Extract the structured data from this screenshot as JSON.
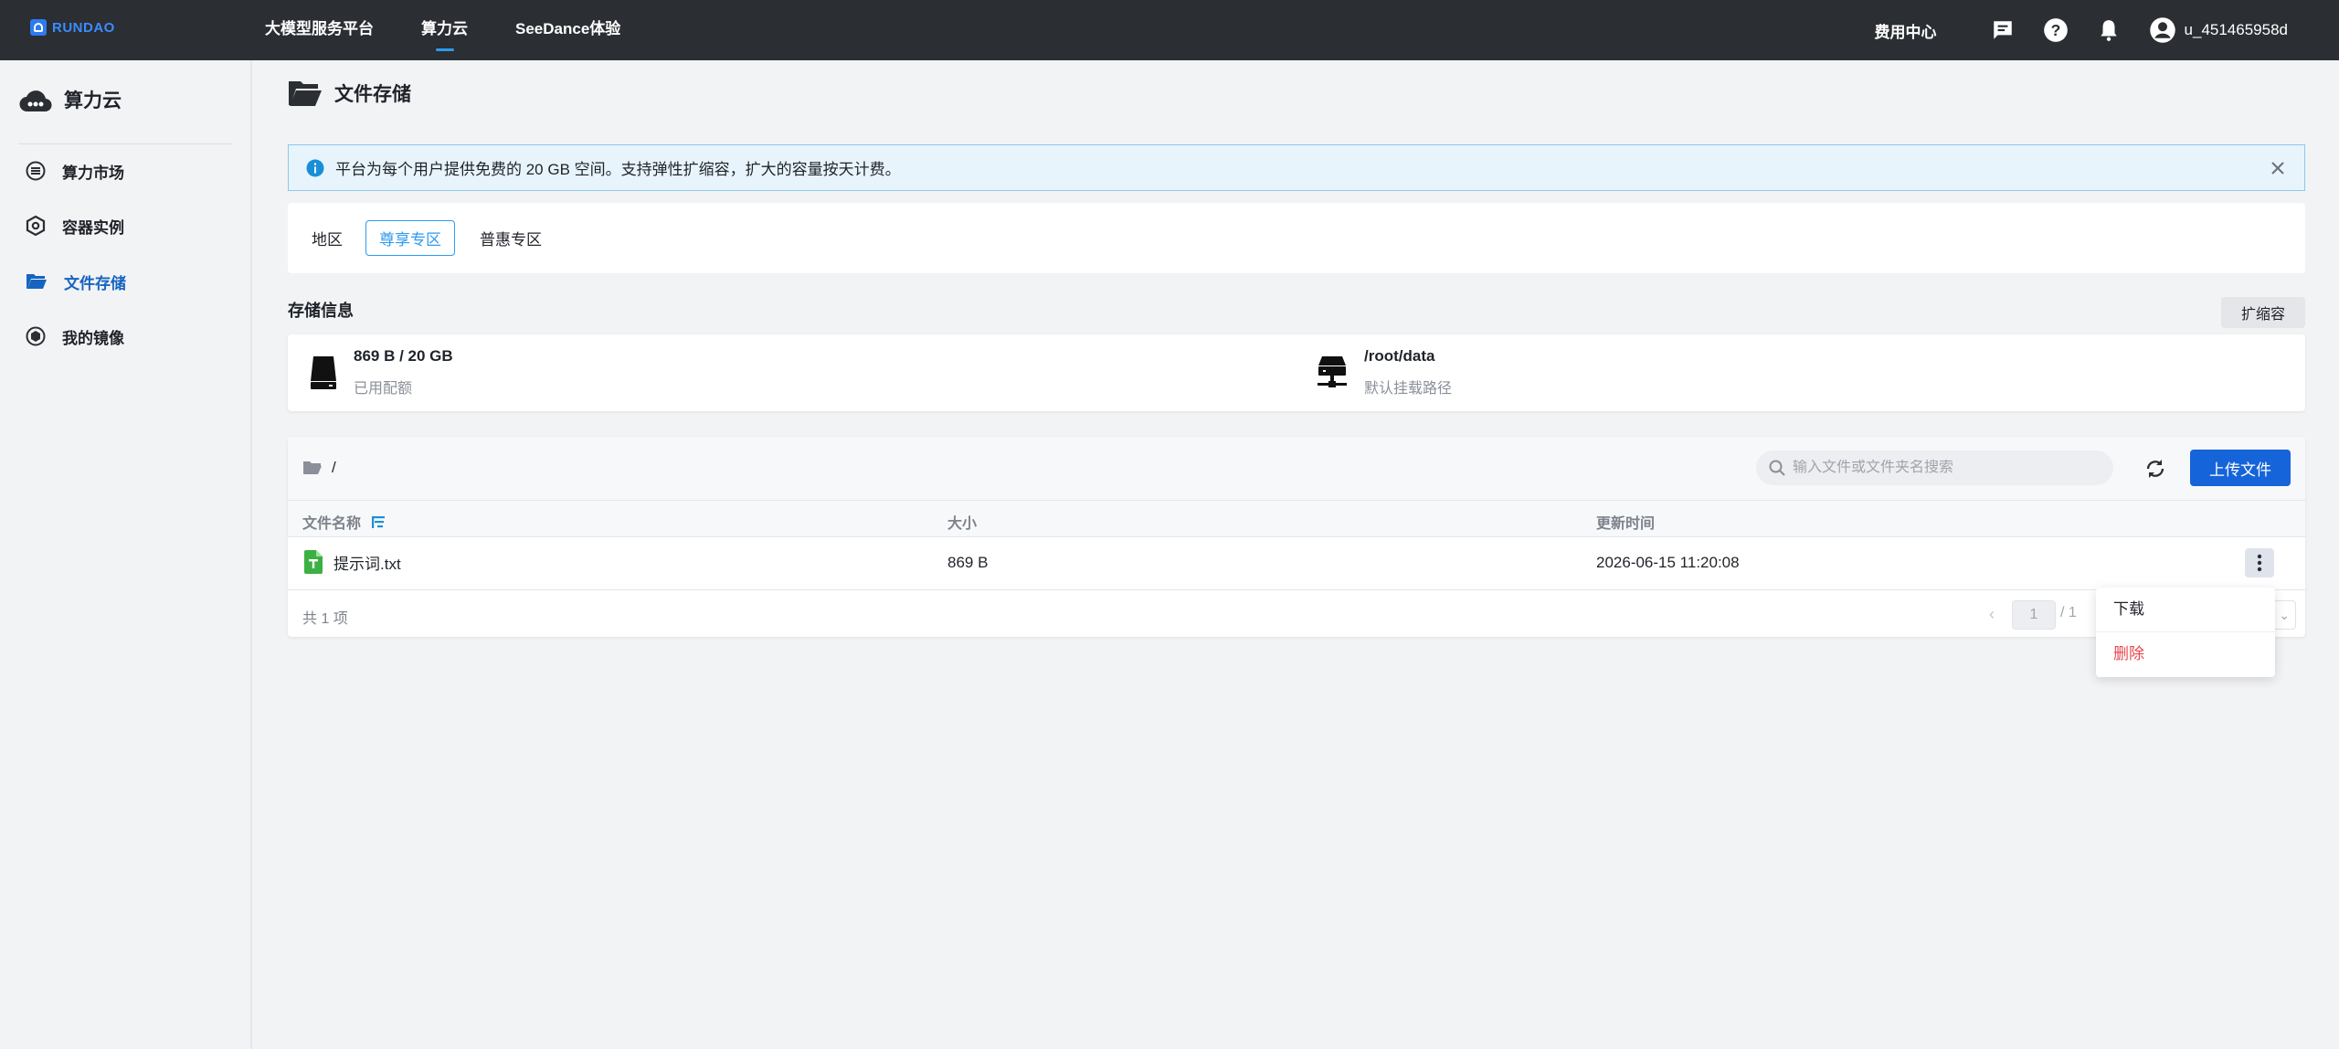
{
  "brand": {
    "logo_text": "RUNDAO"
  },
  "nav": {
    "items": [
      {
        "label": "大模型服务平台"
      },
      {
        "label": "算力云"
      },
      {
        "label": "SeeDance体验"
      }
    ],
    "active": "算力云"
  },
  "header": {
    "fee_center": "费用中心",
    "icons": [
      "message-icon",
      "help-icon",
      "bell-icon",
      "user-avatar-icon"
    ],
    "username": "u_451465958d"
  },
  "sidebar": {
    "title": "算力云",
    "items": [
      {
        "label": "算力市场",
        "icon": "market-icon"
      },
      {
        "label": "容器实例",
        "icon": "container-icon"
      },
      {
        "label": "文件存储",
        "icon": "folder-icon"
      },
      {
        "label": "我的镜像",
        "icon": "image-icon"
      }
    ],
    "active": "文件存储"
  },
  "page": {
    "title": "文件存储"
  },
  "notice": {
    "text": "平台为每个用户提供免费的 20 GB 空间。支持弹性扩缩容，扩大的容量按天计费。"
  },
  "region": {
    "label": "地区",
    "options": [
      "尊享专区",
      "普惠专区"
    ],
    "selected": "尊享专区"
  },
  "storage": {
    "section_title": "存储信息",
    "expand_label": "扩缩容",
    "quota_value": "869 B / 20 GB",
    "quota_label": "已用配额",
    "mount_value": "/root/data",
    "mount_label": "默认挂载路径"
  },
  "files": {
    "path": "/",
    "search_placeholder": "输入文件或文件夹名搜索",
    "upload_label": "上传文件",
    "columns": {
      "name": "文件名称",
      "size": "大小",
      "updated": "更新时间"
    },
    "rows": [
      {
        "name": "提示词.txt",
        "size": "869 B",
        "updated": "2026-06-15 11:20:08"
      }
    ],
    "total": "共 1 项",
    "page_current": "1",
    "page_total": "/ 1"
  },
  "context_menu": {
    "download": "下载",
    "delete": "删除"
  },
  "colors": {
    "accent": "#1664d9",
    "topbar": "#2b2e33",
    "danger": "#e5484d",
    "notice_bg": "#e8f4fb"
  }
}
